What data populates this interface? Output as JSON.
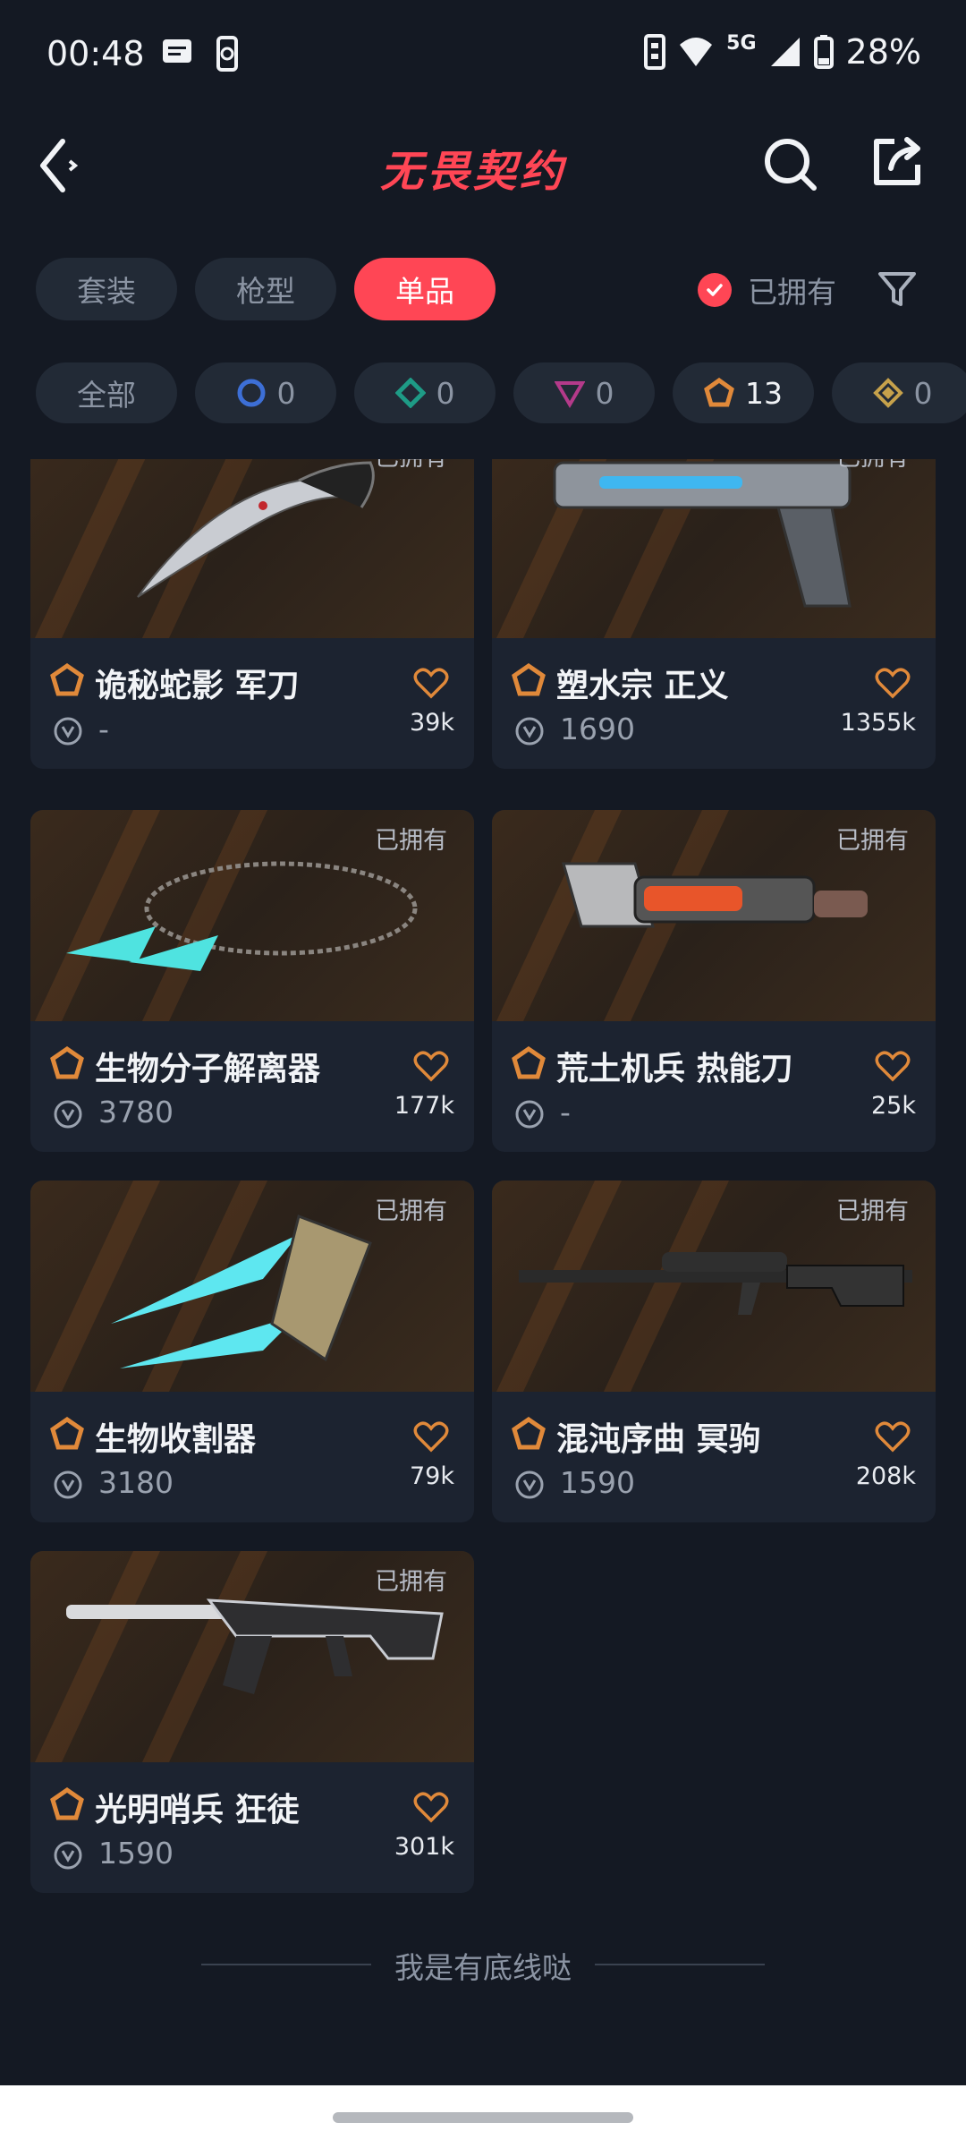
{
  "status_bar": {
    "time": "00:48",
    "network": "5G",
    "battery": "28%"
  },
  "header": {
    "logo_text": "无畏契约"
  },
  "tabs": [
    {
      "label": "套装",
      "active": false
    },
    {
      "label": "枪型",
      "active": false
    },
    {
      "label": "单品",
      "active": true
    }
  ],
  "owned_filter": {
    "label": "已拥有",
    "checked": true
  },
  "tiers": [
    {
      "label": "全部",
      "count": ""
    },
    {
      "label": "",
      "count": "0",
      "color": "#3d6fd6",
      "icon": "select-tier-icon"
    },
    {
      "label": "",
      "count": "0",
      "color": "#1e9b86",
      "icon": "deluxe-tier-icon"
    },
    {
      "label": "",
      "count": "0",
      "color": "#b43a8a",
      "icon": "premium-tier-icon"
    },
    {
      "label": "",
      "count": "13",
      "color": "#e0893a",
      "icon": "exclusive-tier-icon"
    },
    {
      "label": "",
      "count": "0",
      "color": "#c6a14b",
      "icon": "ultra-tier-icon"
    }
  ],
  "items": [
    {
      "name": "诡秘蛇影 军刀",
      "price": "-",
      "likes": "39k",
      "owned_label": "已拥有"
    },
    {
      "name": "塑水宗 正义",
      "price": "1690",
      "likes": "1355k",
      "owned_label": "已拥有"
    },
    {
      "name": "生物分子解离器",
      "price": "3780",
      "likes": "177k",
      "owned_label": "已拥有"
    },
    {
      "name": "荒土机兵 热能刀",
      "price": "-",
      "likes": "25k",
      "owned_label": "已拥有"
    },
    {
      "name": "生物收割器",
      "price": "3180",
      "likes": "79k",
      "owned_label": "已拥有"
    },
    {
      "name": "混沌序曲 冥驹",
      "price": "1590",
      "likes": "208k",
      "owned_label": "已拥有"
    },
    {
      "name": "光明哨兵 狂徒",
      "price": "1590",
      "likes": "301k",
      "owned_label": "已拥有"
    }
  ],
  "footer_text": "我是有底线哒",
  "colors": {
    "accent": "#ff4655",
    "tier_exclusive": "#e0893a",
    "background": "#141923"
  }
}
